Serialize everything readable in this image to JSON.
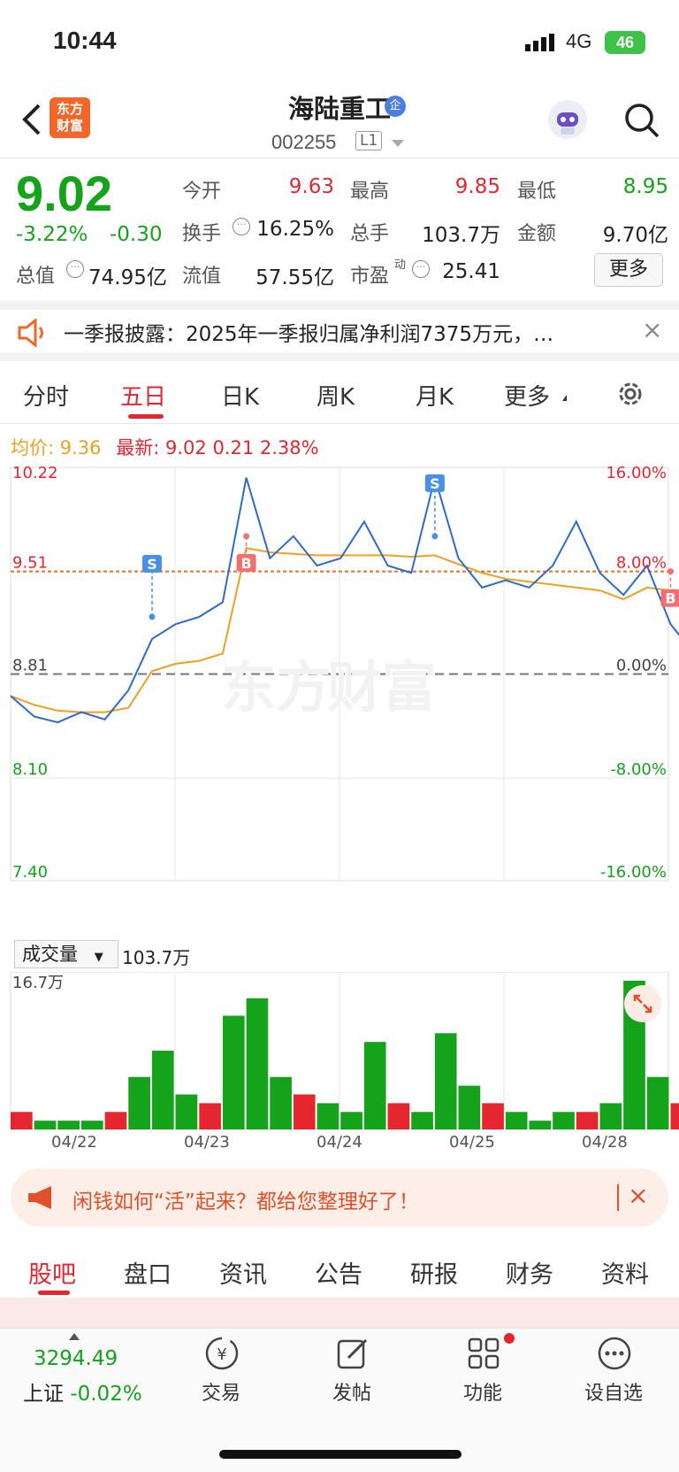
{
  "status": {
    "time": "10:44",
    "network": "4G",
    "battery": "46"
  },
  "header": {
    "logo_line1": "东方",
    "logo_line2": "财富",
    "stock_name": "海陆重工",
    "badge": "企",
    "stock_code": "002255",
    "level": "L1"
  },
  "quote": {
    "price": "9.02",
    "pct_change": "-3.22%",
    "change": "-0.30",
    "market_value_label": "总值",
    "market_value": "74.95亿",
    "rows": [
      [
        {
          "label": "今开",
          "value": "9.63",
          "color": "red"
        },
        {
          "label": "最高",
          "value": "9.85",
          "color": "red"
        },
        {
          "label": "最低",
          "value": "8.95",
          "color": "green"
        }
      ],
      [
        {
          "label": "换手",
          "value": "16.25%",
          "color": "black"
        },
        {
          "label": "总手",
          "value": "103.7万",
          "color": "black"
        },
        {
          "label": "金额",
          "value": "9.70亿",
          "color": "black"
        }
      ],
      [
        {
          "label": "流值",
          "value": "57.55亿",
          "color": "black"
        },
        {
          "label": "市盈",
          "value": "25.41",
          "color": "black"
        }
      ]
    ],
    "pe_sup": "动",
    "more": "更多"
  },
  "news": {
    "text": "一季报披露：2025年一季报归属净利润7375万元，…"
  },
  "chart_tabs": [
    "分时",
    "五日",
    "日K",
    "周K",
    "月K",
    "更多"
  ],
  "legend": {
    "avg_label": "均价:",
    "avg_value": "9.36",
    "latest_label": "最新:",
    "latest_value": "9.02",
    "latest_change": "0.21",
    "latest_pct": "2.38%"
  },
  "chart_data": {
    "type": "line",
    "x": [
      "04/22",
      "04/23",
      "04/24",
      "04/25",
      "04/28"
    ],
    "y_ticks_left": [
      "10.22",
      "9.51",
      "8.81",
      "8.10",
      "7.40"
    ],
    "y_ticks_right": [
      "16.00%",
      "8.00%",
      "0.00%",
      "-8.00%",
      "-16.00%"
    ],
    "ylim": [
      7.4,
      10.22
    ],
    "reference_price": 8.81,
    "series": [
      {
        "values": [
          8.66,
          8.52,
          8.48,
          8.55,
          8.5,
          8.7,
          9.05,
          9.15,
          9.2,
          9.3,
          10.15,
          9.6,
          9.75,
          9.55,
          9.6,
          9.85,
          9.55,
          9.5,
          10.15,
          9.6,
          9.4,
          9.45,
          9.4,
          9.55,
          9.85,
          9.5,
          9.35,
          9.55,
          9.15,
          8.95,
          9.02
        ]
      },
      {
        "values": [
          8.66,
          8.6,
          8.56,
          8.55,
          8.55,
          8.58,
          8.83,
          8.88,
          8.9,
          8.95,
          9.67,
          9.64,
          9.63,
          9.62,
          9.62,
          9.62,
          9.62,
          9.61,
          9.62,
          9.56,
          9.5,
          9.46,
          9.44,
          9.42,
          9.4,
          9.38,
          9.32,
          9.4,
          9.38,
          9.36,
          9.36
        ]
      }
    ],
    "trade_markers": [
      {
        "label": "S",
        "x_index": 6,
        "price": 9.2
      },
      {
        "label": "B",
        "x_index": 10,
        "price": 9.75
      },
      {
        "label": "S",
        "x_index": 18,
        "price": 9.75
      },
      {
        "label": "B",
        "x_index": 28,
        "price": 9.51
      }
    ],
    "volume": {
      "label": "成交量",
      "total": "103.7万",
      "max_label": "16.7万",
      "values": [
        2,
        1,
        1,
        1,
        2,
        6,
        9,
        4,
        3,
        13,
        15,
        6,
        4,
        3,
        2,
        10,
        3,
        2,
        11,
        5,
        3,
        2,
        1,
        2,
        2,
        3,
        17,
        6,
        3,
        2
      ]
    }
  },
  "promo": {
    "text": "闲钱如何“活”起来？都给您整理好了！"
  },
  "info_tabs": [
    "股吧",
    "盘口",
    "资讯",
    "公告",
    "研报",
    "财务",
    "资料"
  ],
  "bottom": {
    "index_value": "3294.49",
    "index_name": "上证",
    "index_pct": "-0.02%",
    "buttons": [
      "交易",
      "发帖",
      "功能",
      "设自选"
    ]
  }
}
